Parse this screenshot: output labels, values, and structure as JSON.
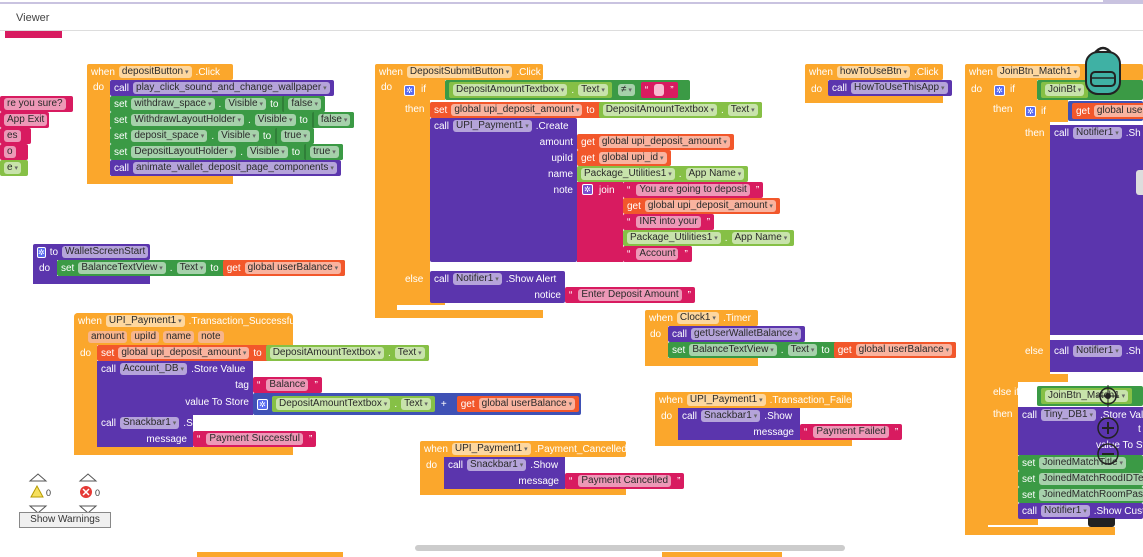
{
  "header": {
    "title": "Viewer"
  },
  "kw": {
    "when": "when",
    "do": "do",
    "call": "call",
    "set": "set",
    "to": "to",
    "get": "get",
    "if": "if",
    "then": "then",
    "else": "else",
    "else_if": "else if",
    "join": "join",
    "dot": ".",
    "plus": "+",
    "neq": "≠"
  },
  "colors": {
    "event": "#fba72c",
    "procedure": "#5b35ad",
    "setter": "#3b9a45",
    "getter": "#86c046",
    "variable": "#f2572b",
    "text": "#d81b60",
    "math": "#3f51b5"
  },
  "left_fragments": [
    "re you sure?",
    "App Exit",
    "es",
    "o",
    "e"
  ],
  "deposit_click": {
    "component": "depositButton",
    "event": ".Click",
    "proc1": "play_click_sound_and_change_wallpaper",
    "sets": [
      {
        "comp": "withdraw_space",
        "prop": "Visible",
        "val": "false"
      },
      {
        "comp": "WithdrawLayoutHolder",
        "prop": "Visible",
        "val": "false"
      },
      {
        "comp": "deposit_space",
        "prop": "Visible",
        "val": "true"
      },
      {
        "comp": "DepositLayoutHolder",
        "prop": "Visible",
        "val": "true"
      }
    ],
    "proc2": "animate_wallet_deposit_page_components"
  },
  "wallet_start": {
    "name": "WalletScreenStart",
    "comp": "BalanceTextView",
    "prop": "Text",
    "var": "global userBalance"
  },
  "deposit_submit": {
    "component": "DepositSubmitButton",
    "event": ".Click",
    "cond_comp": "DepositAmountTextbox",
    "cond_prop": "Text",
    "set_var": "global upi_deposit_amount",
    "set_comp": "DepositAmountTextbox",
    "set_prop": "Text",
    "call_comp": "UPI_Payment1",
    "call_method": ".Create",
    "p_amount": "amount",
    "p_upiid": "upiId",
    "p_name": "name",
    "p_note": "note",
    "amount_var": "global upi_deposit_amount",
    "upiid_var": "global upi_id",
    "name_comp": "Package_Utilities1",
    "name_prop": "App Name",
    "join1": "You are going to deposit",
    "join2_var": "global upi_deposit_amount",
    "join3": "INR into your",
    "join4_comp": "Package_Utilities1",
    "join4_prop": "App Name",
    "join5": "Account",
    "else_comp": "Notifier1",
    "else_method": ".Show Alert",
    "else_param": "notice",
    "else_val": "Enter Deposit Amount"
  },
  "how_to": {
    "component": "howToUseBtn",
    "event": ".Click",
    "proc": "HowToUseThisApp"
  },
  "join_match": {
    "component": "JoinBtn_Match1",
    "cond1": "JoinBt",
    "inner_var": "global use",
    "n1_comp": "Notifier1",
    "n1_method": ".Sh",
    "n2_comp": "Notifier1",
    "n2_method": ".Sh",
    "cond2": "JoinBtn_Match1",
    "db_comp": "Tiny_DB1",
    "db_method": ".Store Val",
    "db_p1": "t",
    "db_p2": "value To Sto",
    "set1": "JoinedMatchTitle",
    "set2": "JoinedMatchRoodIDTex",
    "set3": "JoinedMatchRoomPass",
    "n3_comp": "Notifier1",
    "n3_method": ".Show Cust"
  },
  "clock": {
    "component": "Clock1",
    "event": ".Timer",
    "proc": "getUserWalletBalance",
    "comp": "BalanceTextView",
    "prop": "Text",
    "var": "global userBalance"
  },
  "tx_success": {
    "component": "UPI_Payment1",
    "event": ".Transaction_Successful",
    "params": [
      "amount",
      "upiId",
      "name",
      "note"
    ],
    "set_var": "global upi_deposit_amount",
    "set_comp": "DepositAmountTextbox",
    "set_prop": "Text",
    "db_comp": "Account_DB",
    "db_method": ".Store Value",
    "tag": "tag",
    "tag_val": "Balance",
    "vts": "value To Store",
    "add_comp": "DepositAmountTextbox",
    "add_prop": "Text",
    "add_var": "global userBalance",
    "sb_comp": "Snackbar1",
    "sb_method": ".Show",
    "sb_param": "message",
    "sb_val": "Payment Successful"
  },
  "tx_failed": {
    "component": "UPI_Payment1",
    "event": ".Transaction_Failed",
    "sb_comp": "Snackbar1",
    "sb_method": ".Show",
    "sb_param": "message",
    "sb_val": "Payment Failed"
  },
  "pay_cancel": {
    "component": "UPI_Payment1",
    "event": ".Payment_Cancelled",
    "sb_comp": "Snackbar1",
    "sb_method": ".Show",
    "sb_param": "message",
    "sb_val": "Payment Cancelled"
  },
  "warnings": {
    "warn_count": "0",
    "error_count": "0",
    "button": "Show Warnings"
  }
}
